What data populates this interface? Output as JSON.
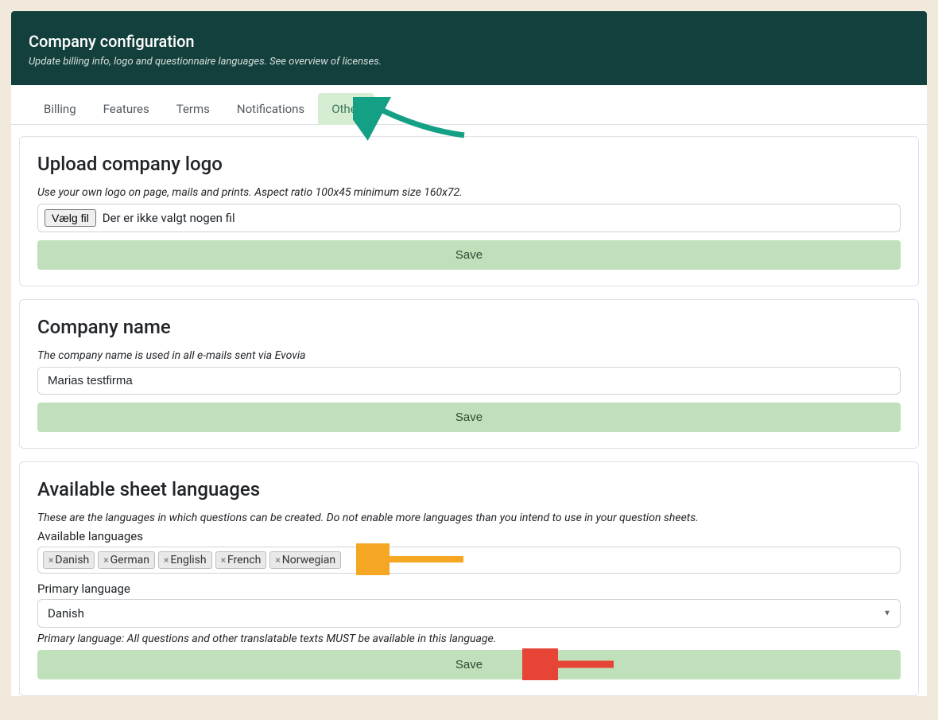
{
  "header": {
    "title": "Company configuration",
    "subtitle": "Update billing info, logo and questionnaire languages. See overview of licenses."
  },
  "tabs": {
    "billing": "Billing",
    "features": "Features",
    "terms": "Terms",
    "notifications": "Notifications",
    "other": "Other"
  },
  "logo_section": {
    "title": "Upload company logo",
    "hint": "Use your own logo on page, mails and prints. Aspect ratio 100x45 minimum size 160x72.",
    "choose_file": "Vælg fil",
    "no_file": "Der er ikke valgt nogen fil",
    "save": "Save"
  },
  "name_section": {
    "title": "Company name",
    "hint": "The company name is used in all e-mails sent via Evovia",
    "value": "Marias testfirma",
    "save": "Save"
  },
  "lang_section": {
    "title": "Available sheet languages",
    "hint": "These are the languages in which questions can be created. Do not enable more languages than you intend to use in your question sheets.",
    "available_label": "Available languages",
    "tags": [
      "Danish",
      "German",
      "English",
      "French",
      "Norwegian"
    ],
    "primary_label": "Primary language",
    "primary_value": "Danish",
    "primary_hint": "Primary language: All questions and other translatable texts MUST be available in this language.",
    "save": "Save"
  }
}
